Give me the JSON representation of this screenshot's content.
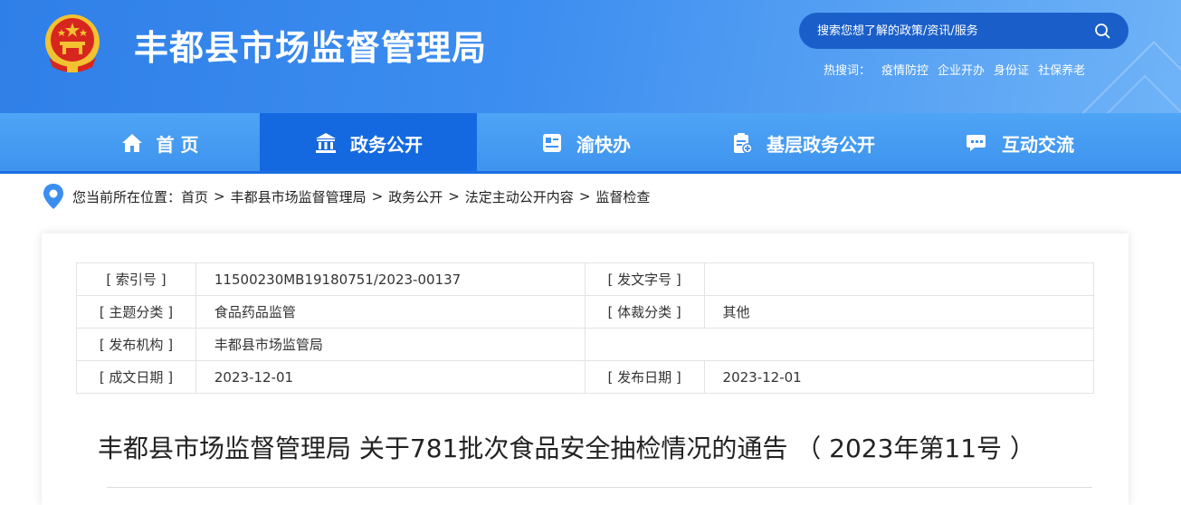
{
  "header": {
    "site_title": "丰都县市场监督管理局",
    "search_placeholder": "搜索您想了解的政策/资讯/服务",
    "hot_label": "热搜词：",
    "hot_words": [
      "疫情防控",
      "企业开办",
      "身份证",
      "社保养老"
    ]
  },
  "nav": {
    "items": [
      {
        "label": "首 页",
        "icon": "home-icon"
      },
      {
        "label": "政务公开",
        "icon": "government-building-icon",
        "active": true
      },
      {
        "label": "渝快办",
        "icon": "service-card-icon"
      },
      {
        "label": "基层政务公开",
        "icon": "clipboard-plus-icon"
      },
      {
        "label": "互动交流",
        "icon": "chat-bubble-icon"
      }
    ]
  },
  "breadcrumb": {
    "prefix": "您当前所在位置：",
    "items": [
      "首页",
      "丰都县市场监督管理局",
      "政务公开",
      "法定主动公开内容",
      "监督检查"
    ],
    "separator": ">"
  },
  "meta": {
    "index_no_label": "[ 索引号 ]",
    "index_no": "11500230MB19180751/2023-00137",
    "doc_no_label": "[ 发文字号 ]",
    "doc_no": "",
    "topic_label": "[ 主题分类 ]",
    "topic": "食品药品监管",
    "genre_label": "[ 体裁分类 ]",
    "genre": "其他",
    "publisher_label": "[ 发布机构 ]",
    "publisher": "丰都县市场监管局",
    "written_date_label": "[ 成文日期 ]",
    "written_date": "2023-12-01",
    "publish_date_label": "[ 发布日期 ]",
    "publish_date": "2023-12-01"
  },
  "article": {
    "title": "丰都县市场监督管理局 关于781批次食品安全抽检情况的通告 （ 2023年第11号 ）"
  },
  "colors": {
    "header_blue": "#2f7fe8",
    "nav_blue": "#4ea4f5",
    "nav_active": "#1469e0",
    "emblem_red": "#d7261e",
    "emblem_gold": "#f2c230"
  }
}
